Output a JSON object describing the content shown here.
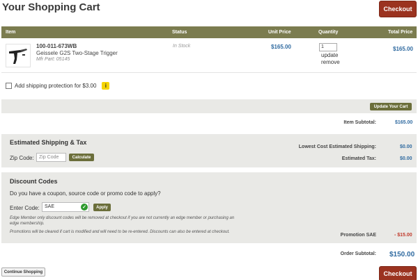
{
  "header": {
    "title": "Your Shopping Cart",
    "checkout_label": "Checkout"
  },
  "table": {
    "columns": {
      "item": "Item",
      "status": "Status",
      "unit_price": "Unit Price",
      "quantity": "Quantity",
      "total_price": "Total Price"
    }
  },
  "item": {
    "sku": "100-011-673WB",
    "name": "Geissele G2S Two-Stage Trigger",
    "mfr_part": "Mfr Part: 05145",
    "status": "In Stock",
    "unit_price": "$165.00",
    "quantity": "1",
    "update_label": "update",
    "remove_label": "remove",
    "total_price": "$165.00"
  },
  "shipping_protection": {
    "label": "Add shipping protection for $3.00",
    "info_glyph": "i"
  },
  "update_cart_label": "Update Your Cart",
  "subtotal": {
    "label": "Item Subtotal:",
    "value": "$165.00"
  },
  "estimate": {
    "title": "Estimated Shipping & Tax",
    "zip_label": "Zip Code:",
    "zip_placeholder": "Zip Code",
    "calculate_label": "Calculate",
    "shipping_label": "Lowest Cost Estimated Shipping:",
    "shipping_value": "$0.00",
    "tax_label": "Estimated Tax:",
    "tax_value": "$0.00"
  },
  "discount": {
    "title": "Discount Codes",
    "question": "Do you have a coupon, source code or promo code to apply?",
    "code_label": "Enter Code:",
    "code_value": "SAE",
    "apply_label": "Apply",
    "note1": "Edge Member only discount codes will be removed at checkout if you are not currently an edge member or purchasing an edge membership.",
    "note2": "Promotions will be cleared if cart is modified and will need to be re-entered. Discounts can also be entered at checkout.",
    "promo_label": "Promotion SAE",
    "promo_value": "- $15.00"
  },
  "order_subtotal": {
    "label": "Order Subtotal:",
    "value": "$150.00"
  },
  "continue_label": "Continue Shopping",
  "colors": {
    "accent": "#9b3320",
    "header_bar": "#7b7c4f",
    "price_blue": "#2f6aa0",
    "promo_red": "#c0392b"
  }
}
